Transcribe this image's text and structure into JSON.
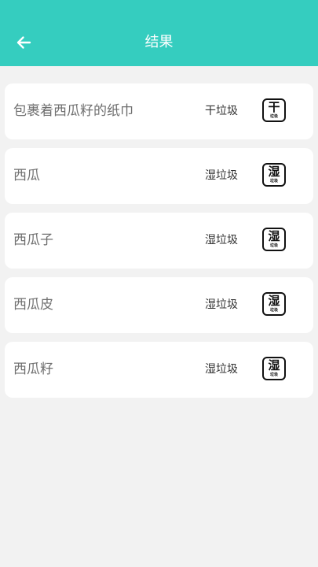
{
  "header": {
    "title": "结果",
    "background_color": "#35cdbf",
    "back_icon": "arrow-left-icon"
  },
  "results": [
    {
      "name": "包裹着西瓜籽的纸巾",
      "category": "干垃圾",
      "badge_main": "干",
      "badge_sub": "垃圾"
    },
    {
      "name": "西瓜",
      "category": "湿垃圾",
      "badge_main": "湿",
      "badge_sub": "垃圾"
    },
    {
      "name": "西瓜子",
      "category": "湿垃圾",
      "badge_main": "湿",
      "badge_sub": "垃圾"
    },
    {
      "name": "西瓜皮",
      "category": "湿垃圾",
      "badge_main": "湿",
      "badge_sub": "垃圾"
    },
    {
      "name": "西瓜籽",
      "category": "湿垃圾",
      "badge_main": "湿",
      "badge_sub": "垃圾"
    }
  ]
}
